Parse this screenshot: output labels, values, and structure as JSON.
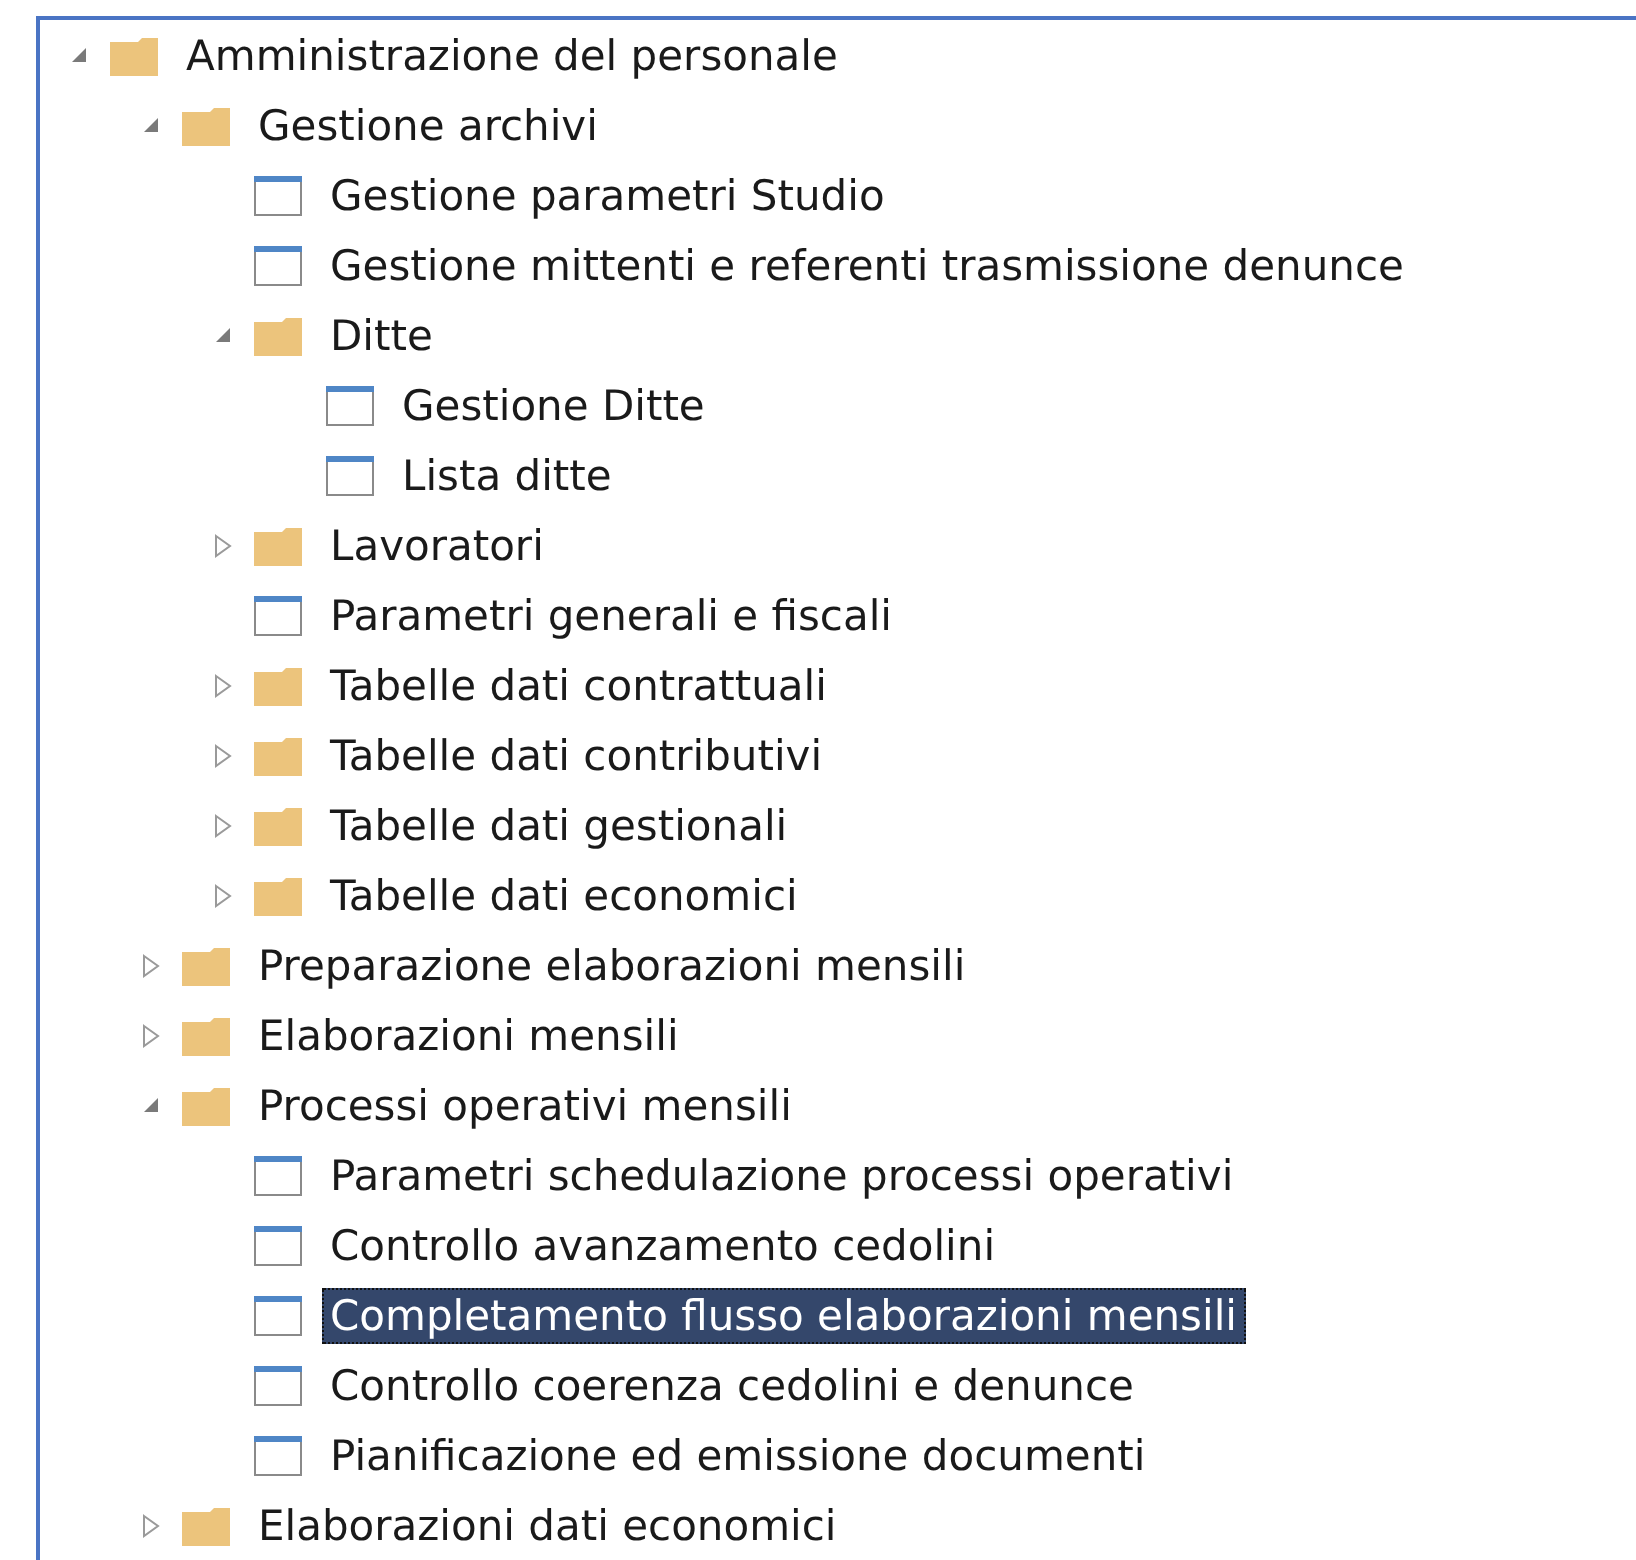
{
  "tree": [
    {
      "kind": "folder",
      "label": "Amministrazione del personale",
      "expanded": true,
      "selected": false,
      "children": [
        {
          "kind": "folder",
          "label": "Gestione archivi",
          "expanded": true,
          "selected": false,
          "children": [
            {
              "kind": "page",
              "label": "Gestione parametri Studio",
              "selected": false
            },
            {
              "kind": "page",
              "label": "Gestione mittenti e referenti trasmissione denunce",
              "selected": false
            },
            {
              "kind": "folder",
              "label": "Ditte",
              "expanded": true,
              "selected": false,
              "children": [
                {
                  "kind": "page",
                  "label": "Gestione Ditte",
                  "selected": false
                },
                {
                  "kind": "page",
                  "label": "Lista ditte",
                  "selected": false
                }
              ]
            },
            {
              "kind": "folder",
              "label": "Lavoratori",
              "expanded": false,
              "selected": false
            },
            {
              "kind": "page",
              "label": "Parametri generali e fiscali",
              "selected": false
            },
            {
              "kind": "folder",
              "label": "Tabelle dati contrattuali",
              "expanded": false,
              "selected": false
            },
            {
              "kind": "folder",
              "label": "Tabelle dati contributivi",
              "expanded": false,
              "selected": false
            },
            {
              "kind": "folder",
              "label": "Tabelle dati gestionali",
              "expanded": false,
              "selected": false
            },
            {
              "kind": "folder",
              "label": "Tabelle dati economici",
              "expanded": false,
              "selected": false
            }
          ]
        },
        {
          "kind": "folder",
          "label": "Preparazione elaborazioni mensili",
          "expanded": false,
          "selected": false
        },
        {
          "kind": "folder",
          "label": "Elaborazioni mensili",
          "expanded": false,
          "selected": false
        },
        {
          "kind": "folder",
          "label": "Processi operativi mensili",
          "expanded": true,
          "selected": false,
          "children": [
            {
              "kind": "page",
              "label": "Parametri schedulazione processi operativi",
              "selected": false
            },
            {
              "kind": "page",
              "label": "Controllo avanzamento cedolini",
              "selected": false
            },
            {
              "kind": "page",
              "label": "Completamento flusso elaborazioni mensili",
              "selected": true
            },
            {
              "kind": "page",
              "label": "Controllo coerenza cedolini e denunce",
              "selected": false
            },
            {
              "kind": "page",
              "label": "Pianificazione ed emissione documenti",
              "selected": false
            }
          ]
        },
        {
          "kind": "folder",
          "label": "Elaborazioni dati economici",
          "expanded": false,
          "selected": false
        }
      ]
    }
  ]
}
